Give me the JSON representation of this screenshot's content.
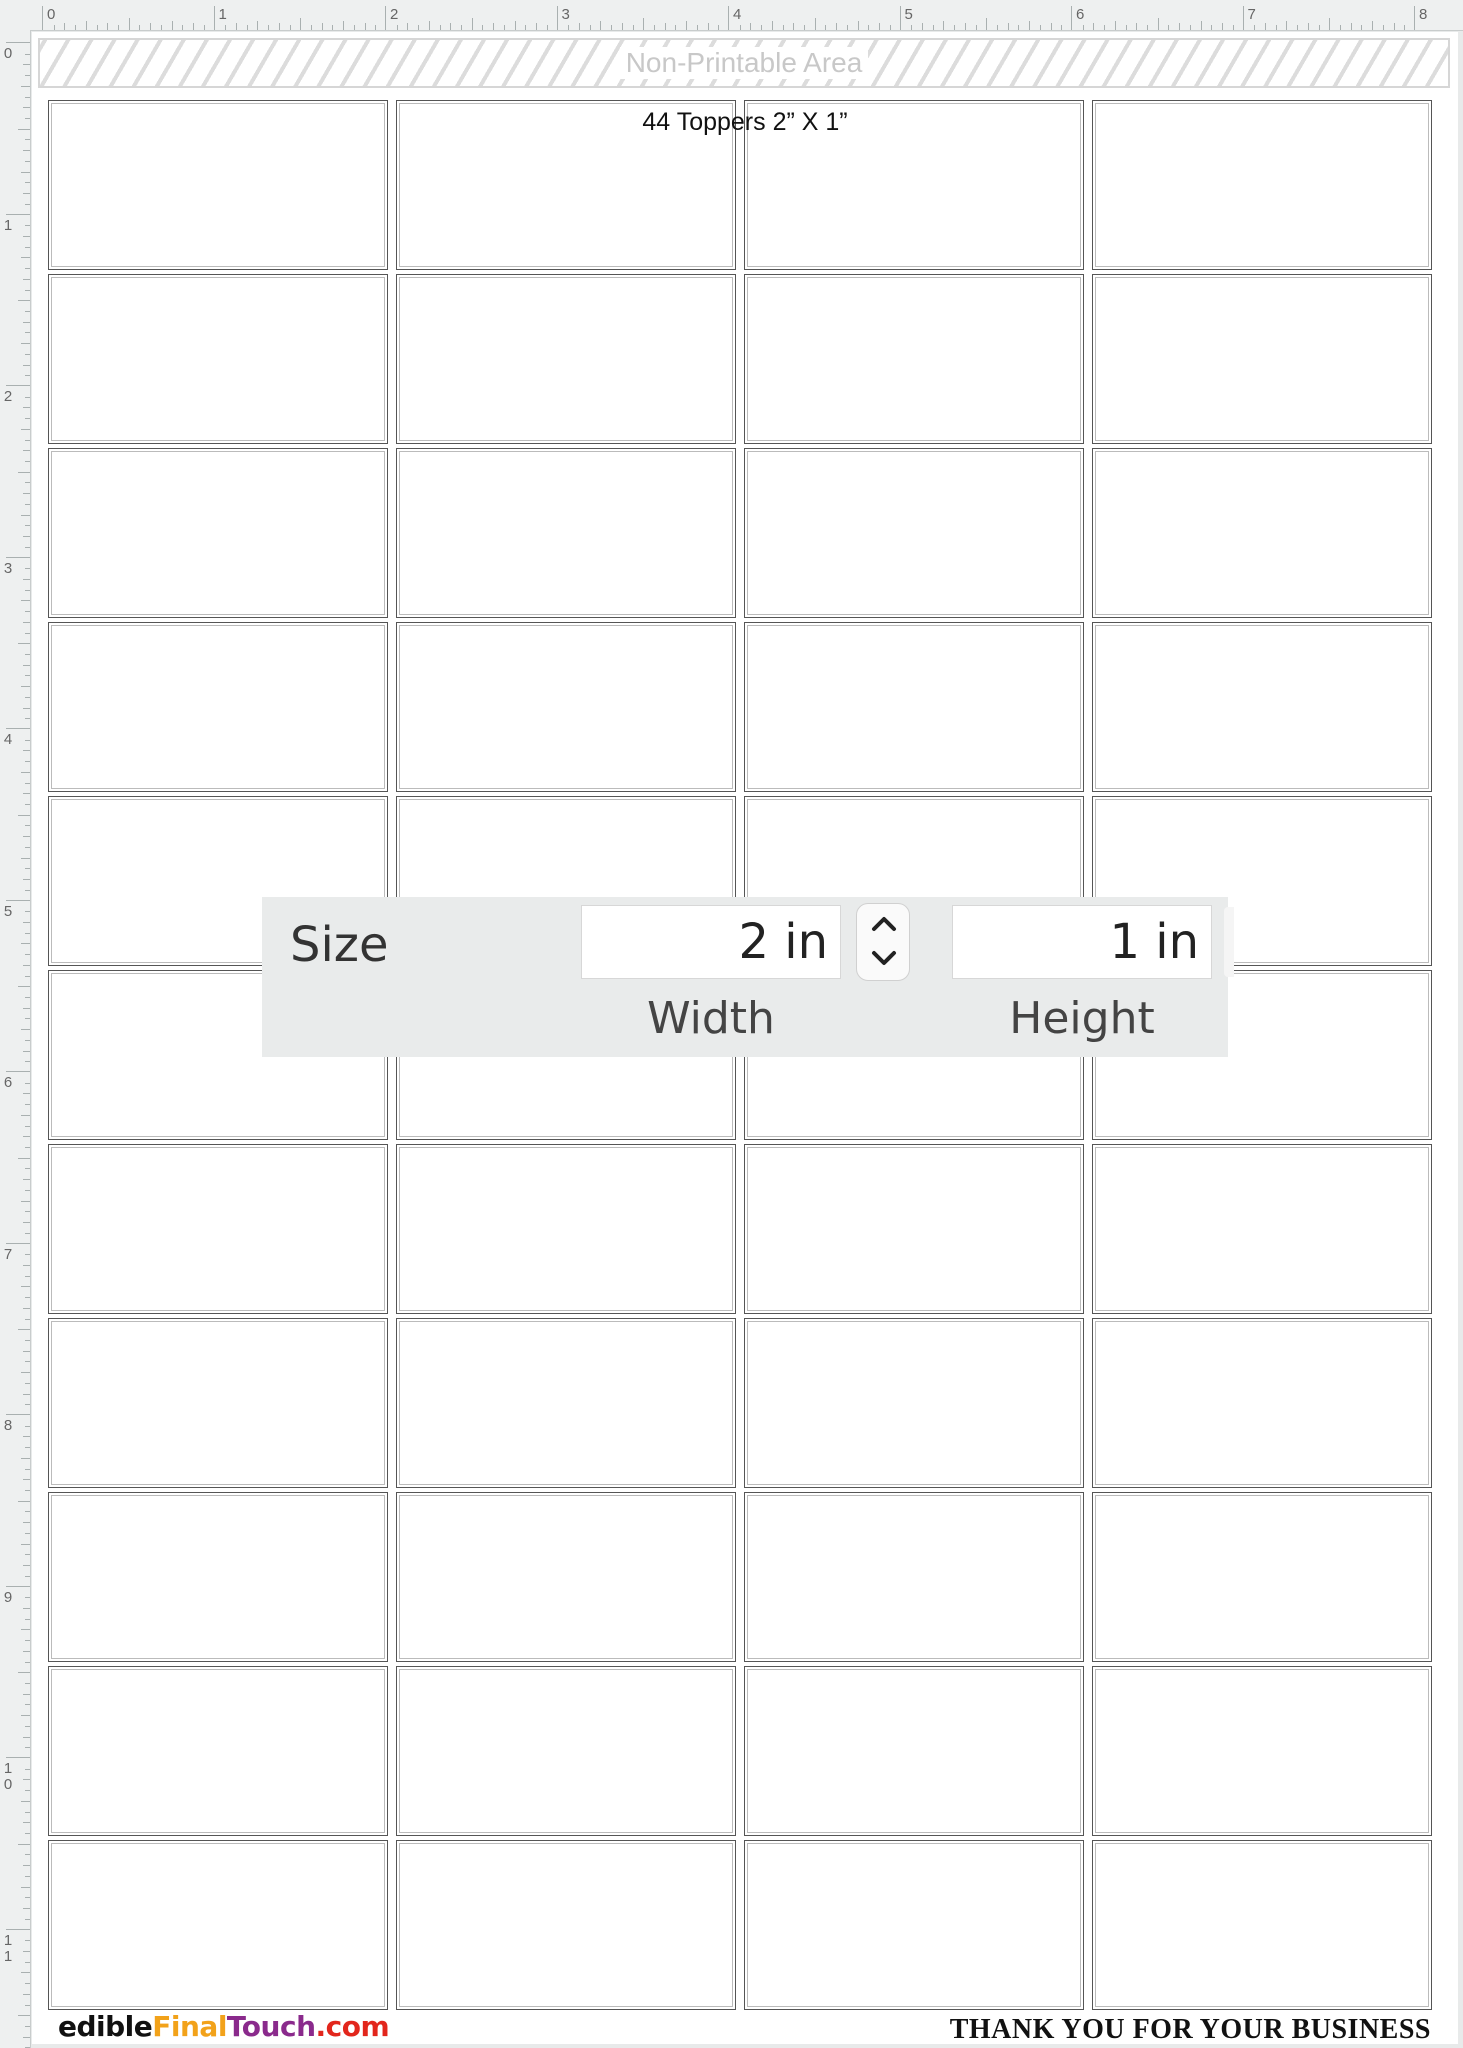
{
  "ruler": {
    "top_labels": [
      "0",
      "1",
      "2",
      "3",
      "4",
      "5",
      "6",
      "7",
      "8"
    ],
    "left_labels": [
      "0",
      "1",
      "2",
      "3",
      "4",
      "5",
      "6",
      "7",
      "8",
      "9",
      "1\n0",
      "1\n1"
    ]
  },
  "page": {
    "non_printable_label": "Non-Printable Area",
    "sheet_title": "44 Toppers 2” X 1”",
    "grid": {
      "rows": 11,
      "columns": 4
    }
  },
  "size_panel": {
    "label": "Size",
    "width_value": "2 in",
    "width_caption": "Width",
    "height_value": "1 in",
    "height_caption": "Height",
    "stepper_icons": [
      "chevron-up-icon",
      "chevron-down-icon"
    ]
  },
  "footer": {
    "brand_parts": [
      "edible",
      "Final",
      "Touch",
      ".com"
    ],
    "brand_colors": [
      "#111111",
      "#f2a21a",
      "#8a2a8c",
      "#e2261c"
    ],
    "thanks": "THANK YOU FOR YOUR BUSINESS"
  }
}
